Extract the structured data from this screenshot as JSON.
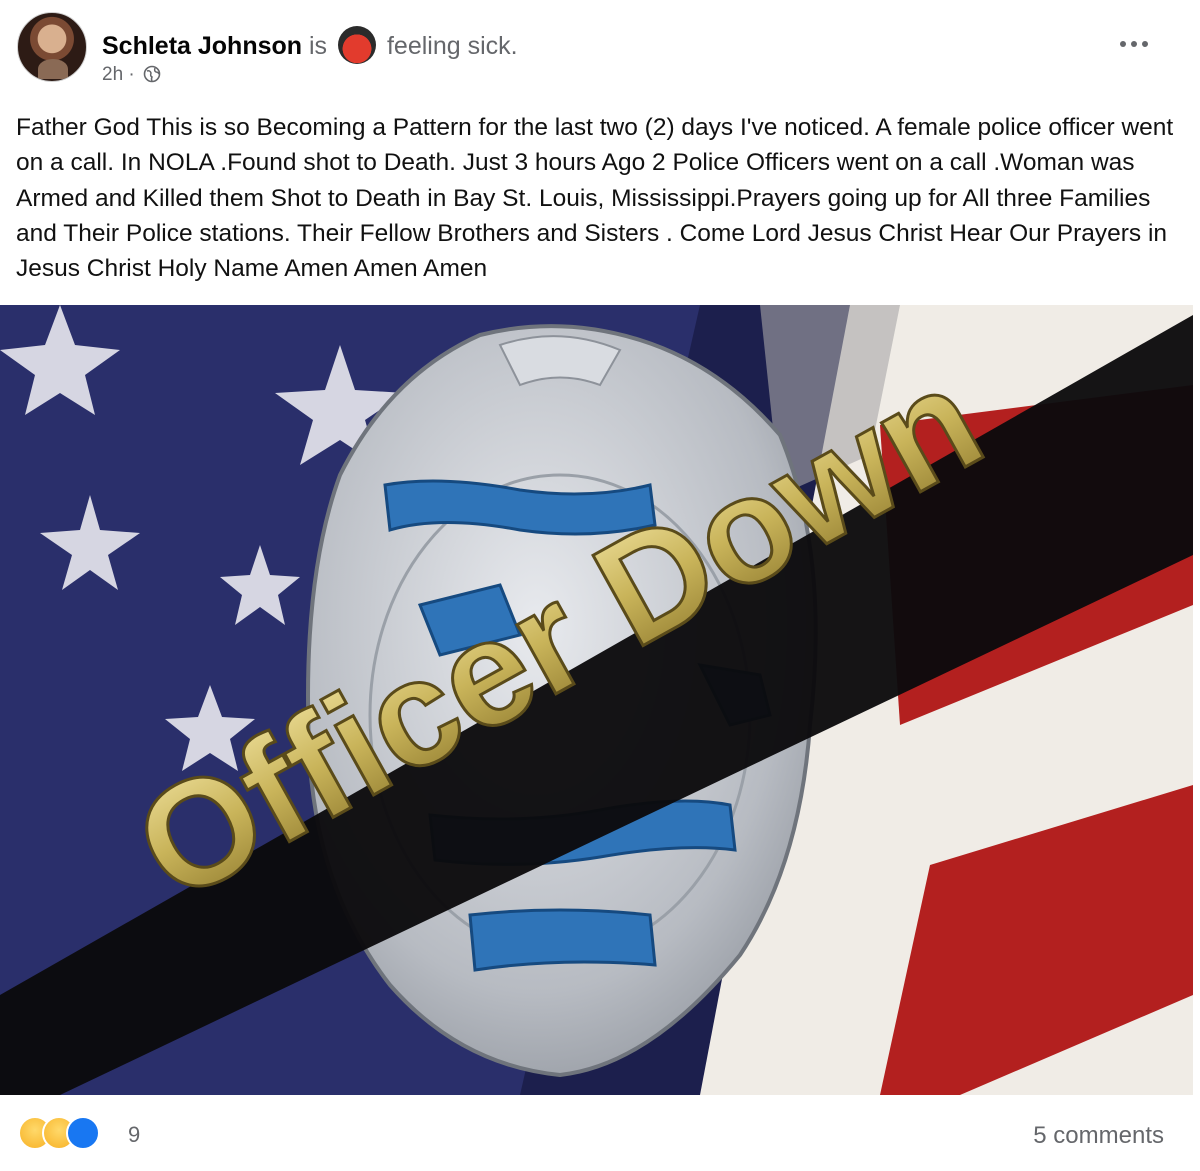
{
  "post": {
    "author": "Schleta Johnson",
    "is_word": "is",
    "feeling": "feeling sick.",
    "feeling_icon": "sick-face-icon",
    "timestamp": "2h",
    "separator": "·",
    "audience_icon": "globe-icon",
    "more_icon": "more-options-icon",
    "text": "Father God This is so Becoming a Pattern for the last two (2) days I've noticed. A female police officer  went on a call. In NOLA .Found shot to Death. Just 3 hours Ago 2 Police Officers went on a call .Woman was Armed and Killed them Shot to Death in Bay St. Louis, Mississippi.Prayers going up for All three Families and Their Police stations.  Their Fellow Brothers and Sisters . Come Lord Jesus Christ  Hear Our Prayers  in Jesus Christ Holy Name Amen  Amen Amen"
  },
  "image": {
    "banner_text": "Officer Down",
    "colors": {
      "banner": "#0b0a0c",
      "gold": "#c9b45a",
      "flag_blue": "#2a2f6b",
      "flag_red": "#b3201f",
      "badge_blue": "#2f74b8",
      "badge_silver": "#c9ccd1"
    }
  },
  "reactions": {
    "icons": [
      "sad-reaction-icon",
      "care-reaction-icon",
      "like-reaction-icon"
    ],
    "count": "9",
    "comments": "5 comments"
  }
}
